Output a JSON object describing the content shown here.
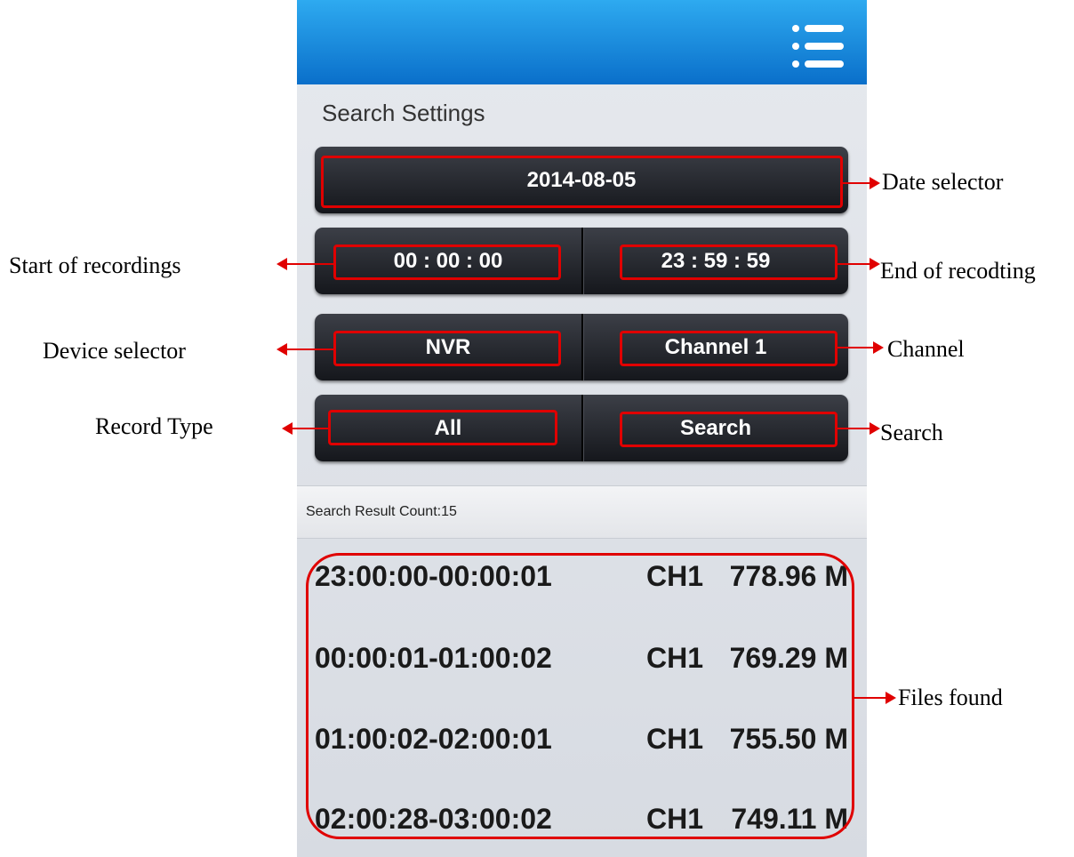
{
  "app": {
    "section_title": "Search Settings",
    "menu_icon": "hamburger-list-icon"
  },
  "controls": {
    "date": "2014-08-05",
    "start_time": "00 : 00 : 00",
    "end_time": "23 : 59 : 59",
    "device": "NVR",
    "channel": "Channel 1",
    "record_type": "All",
    "search": "Search"
  },
  "results": {
    "count_label": "Search Result Count:15",
    "items": [
      {
        "time": "23:00:00-00:00:01",
        "channel": "CH1",
        "size": "778.96 M"
      },
      {
        "time": "00:00:01-01:00:02",
        "channel": "CH1",
        "size": "769.29 M"
      },
      {
        "time": "01:00:02-02:00:01",
        "channel": "CH1",
        "size": "755.50 M"
      },
      {
        "time": "02:00:28-03:00:02",
        "channel": "CH1",
        "size": "749.11 M"
      }
    ]
  },
  "annotations": {
    "date_selector": "Date selector",
    "start": "Start of recordings",
    "end": "End of recodting",
    "device": "Device selector",
    "channel": "Channel",
    "record_type": "Record Type",
    "search": "Search",
    "files": "Files found"
  },
  "colors": {
    "highlight": "#e00000",
    "header_top": "#2eaaf0",
    "header_bottom": "#0a6fca"
  }
}
